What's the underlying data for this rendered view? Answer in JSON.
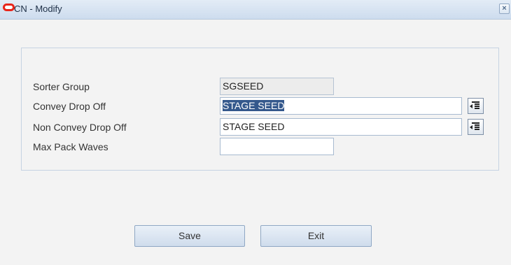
{
  "window": {
    "title": "CN - Modify",
    "close_glyph": "×"
  },
  "form": {
    "sorter_group": {
      "label": "Sorter Group",
      "value": "SGSEED"
    },
    "convey_drop_off": {
      "label": "Convey Drop Off",
      "value": "STAGE SEED"
    },
    "non_convey_drop_off": {
      "label": "Non Convey Drop Off",
      "value": "STAGE SEED"
    },
    "max_pack_waves": {
      "label": "Max Pack Waves",
      "value": ""
    }
  },
  "buttons": {
    "save": "Save",
    "exit": "Exit"
  },
  "icons": {
    "logo": "oracle-logo-icon",
    "lov": "list-of-values-icon",
    "close": "close-icon"
  },
  "colors": {
    "titlebar": "#cddcee",
    "selection": "#34588c",
    "logo": "#e8251b"
  }
}
